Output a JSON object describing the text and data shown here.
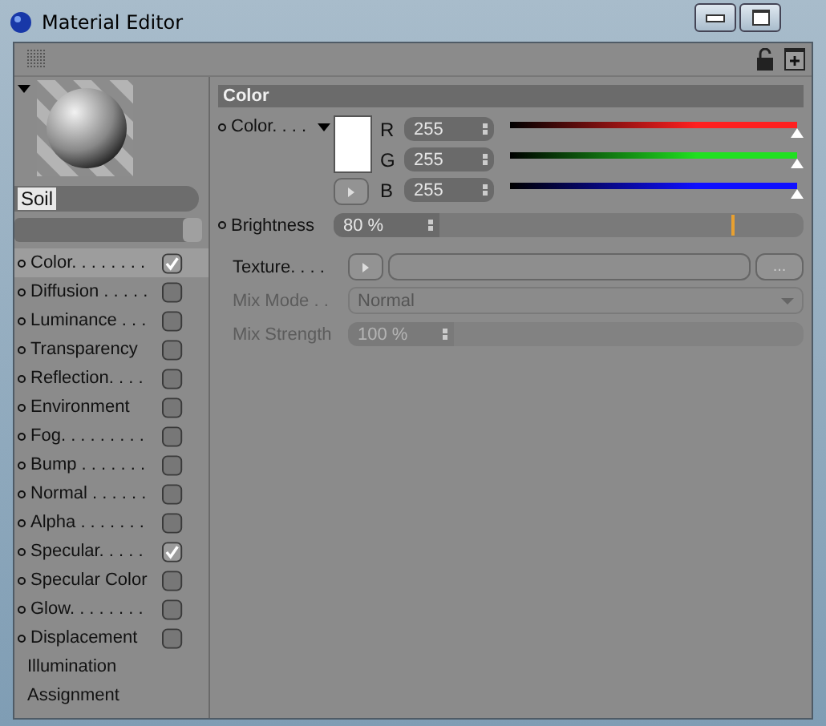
{
  "window": {
    "title": "Material Editor"
  },
  "preview": {
    "name": "Soil"
  },
  "channels": [
    {
      "label": "Color. . . . . . . .",
      "checked": true,
      "selected": true
    },
    {
      "label": "Diffusion . . . . .",
      "checked": false,
      "selected": false
    },
    {
      "label": "Luminance . . .",
      "checked": false,
      "selected": false
    },
    {
      "label": "Transparency",
      "checked": false,
      "selected": false
    },
    {
      "label": "Reflection. . . .",
      "checked": false,
      "selected": false
    },
    {
      "label": "Environment",
      "checked": false,
      "selected": false
    },
    {
      "label": "Fog. . . . . . . . .",
      "checked": false,
      "selected": false
    },
    {
      "label": "Bump . . . . . . .",
      "checked": false,
      "selected": false
    },
    {
      "label": "Normal . . . . . .",
      "checked": false,
      "selected": false
    },
    {
      "label": "Alpha . . . . . . .",
      "checked": false,
      "selected": false
    },
    {
      "label": "Specular. . . . .",
      "checked": true,
      "selected": false
    },
    {
      "label": "Specular Color",
      "checked": false,
      "selected": false
    },
    {
      "label": "Glow. . . . . . . .",
      "checked": false,
      "selected": false
    },
    {
      "label": "Displacement",
      "checked": false,
      "selected": false
    }
  ],
  "extra_items": [
    "Illumination",
    "Assignment"
  ],
  "section": {
    "title": "Color"
  },
  "color": {
    "label": "Color. . . .",
    "components": [
      {
        "name": "R",
        "value": "255",
        "level": 1,
        "color": "#ff2020"
      },
      {
        "name": "G",
        "value": "255",
        "level": 1,
        "color": "#20e020"
      },
      {
        "name": "B",
        "value": "255",
        "level": 1,
        "color": "#1010ff"
      }
    ]
  },
  "brightness": {
    "label": "Brightness",
    "value": "80 %",
    "level": 0.8
  },
  "texture": {
    "label": "Texture. . . .",
    "button": "..."
  },
  "mix_mode": {
    "label": "Mix Mode . .",
    "value": "Normal",
    "disabled": true
  },
  "mix_strength": {
    "label": "Mix Strength",
    "value": "100 %",
    "disabled": true
  }
}
